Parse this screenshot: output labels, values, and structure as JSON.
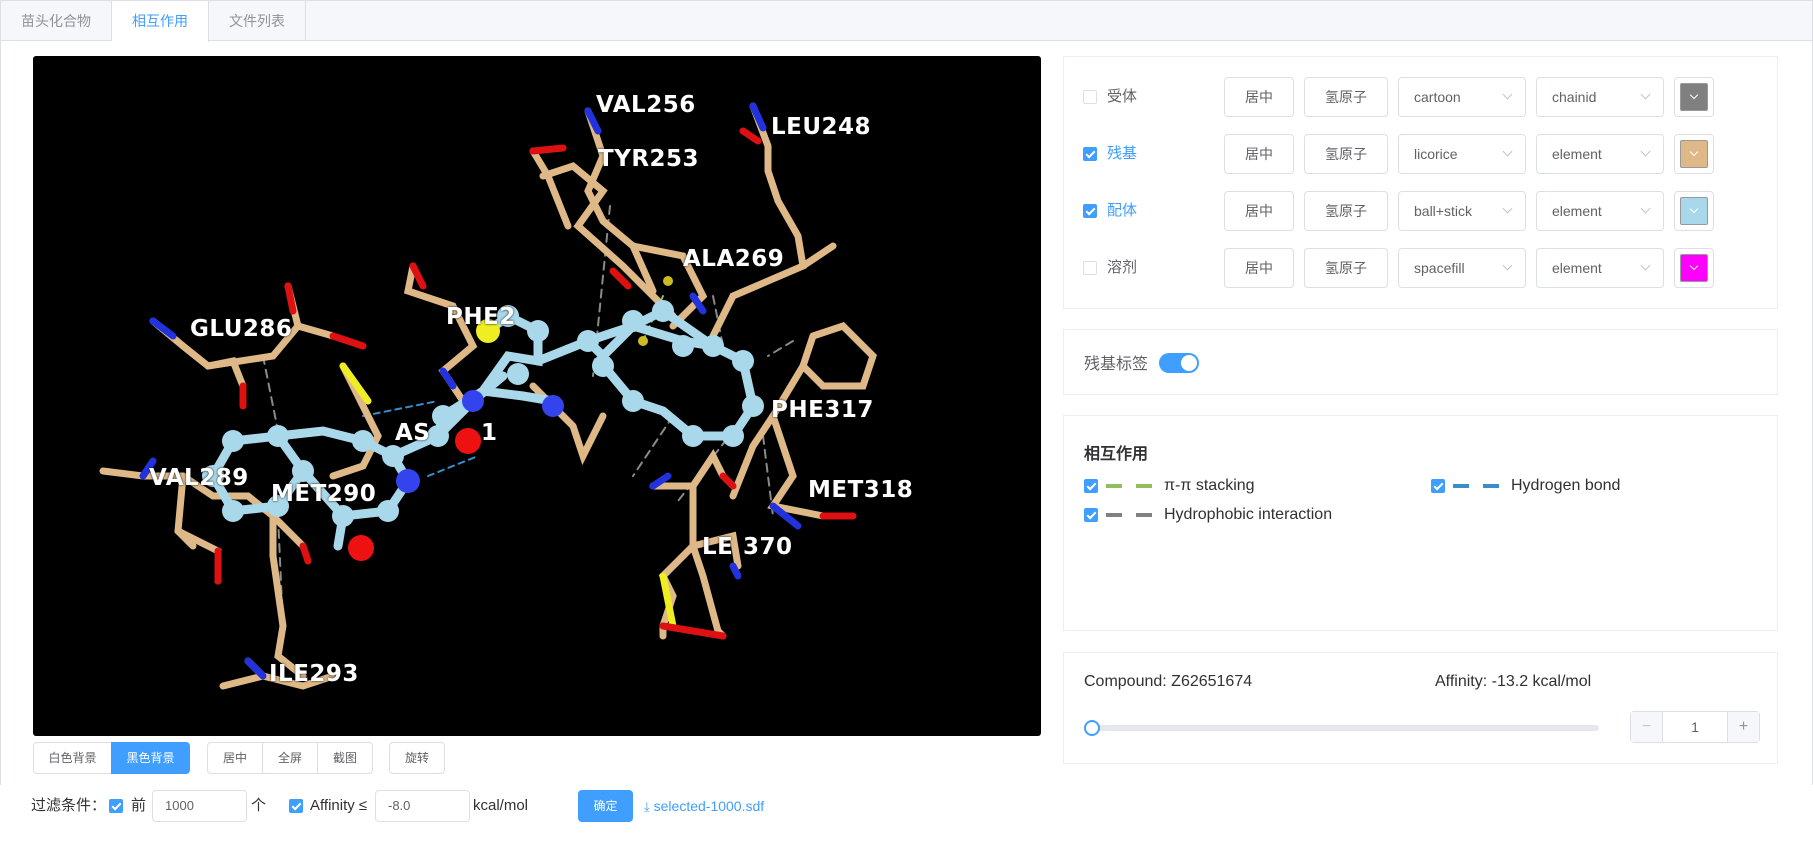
{
  "tabs": [
    {
      "label": "苗头化合物"
    },
    {
      "label": "相互作用"
    },
    {
      "label": "文件列表"
    }
  ],
  "active_tab": "相互作用",
  "viewer": {
    "background": "#000000",
    "residue_labels": [
      "VAL256",
      "TYR253",
      "LEU248",
      "ALA269",
      "GLU286",
      "PHE2",
      "AS",
      "1",
      "PHE317",
      "VAL289",
      "MET290",
      "MET318",
      "LE",
      "370",
      "ILE293"
    ]
  },
  "view_buttons": {
    "white_bg": "白色背景",
    "black_bg": "黑色背景",
    "center": "居中",
    "fullscreen": "全屏",
    "screenshot": "截图",
    "rotate": "旋转"
  },
  "filter": {
    "label": "过滤条件：",
    "top_label": "前",
    "top_value": "1000",
    "top_unit": "个",
    "affinity_label": "Affinity ≤",
    "affinity_value": "-8.0",
    "affinity_unit": "kcal/mol",
    "confirm": "确定",
    "download_link": "selected-1000.sdf"
  },
  "representations": [
    {
      "label": "受体",
      "checked": false,
      "center": "居中",
      "hydrogen": "氢原子",
      "style": "cartoon",
      "color_scheme": "chainid",
      "color": "#808080"
    },
    {
      "label": "残基",
      "checked": true,
      "center": "居中",
      "hydrogen": "氢原子",
      "style": "licorice",
      "color_scheme": "element",
      "color": "#deb887"
    },
    {
      "label": "配体",
      "checked": true,
      "center": "居中",
      "hydrogen": "氢原子",
      "style": "ball+stick",
      "color_scheme": "element",
      "color": "#a8d8ea"
    },
    {
      "label": "溶剂",
      "checked": false,
      "center": "居中",
      "hydrogen": "氢原子",
      "style": "spacefill",
      "color_scheme": "element",
      "color": "#ff00ff"
    }
  ],
  "residue_label_toggle": {
    "label": "残基标签",
    "on": true
  },
  "interactions": {
    "title": "相互作用",
    "items": [
      {
        "label": "π-π stacking",
        "color": "#8fbf5a",
        "checked": true
      },
      {
        "label": "Hydrogen bond",
        "color": "#3a8dc8",
        "checked": true
      },
      {
        "label": "Hydrophobic interaction",
        "color": "#808080",
        "checked": true
      }
    ]
  },
  "compound": {
    "name_text": "Compound: Z62651674",
    "affinity_text": "Affinity: -13.2 kcal/mol",
    "slider_fraction": 0,
    "stepper_value": "1",
    "minus": "−",
    "plus": "+"
  },
  "accent_color": "#409eff"
}
